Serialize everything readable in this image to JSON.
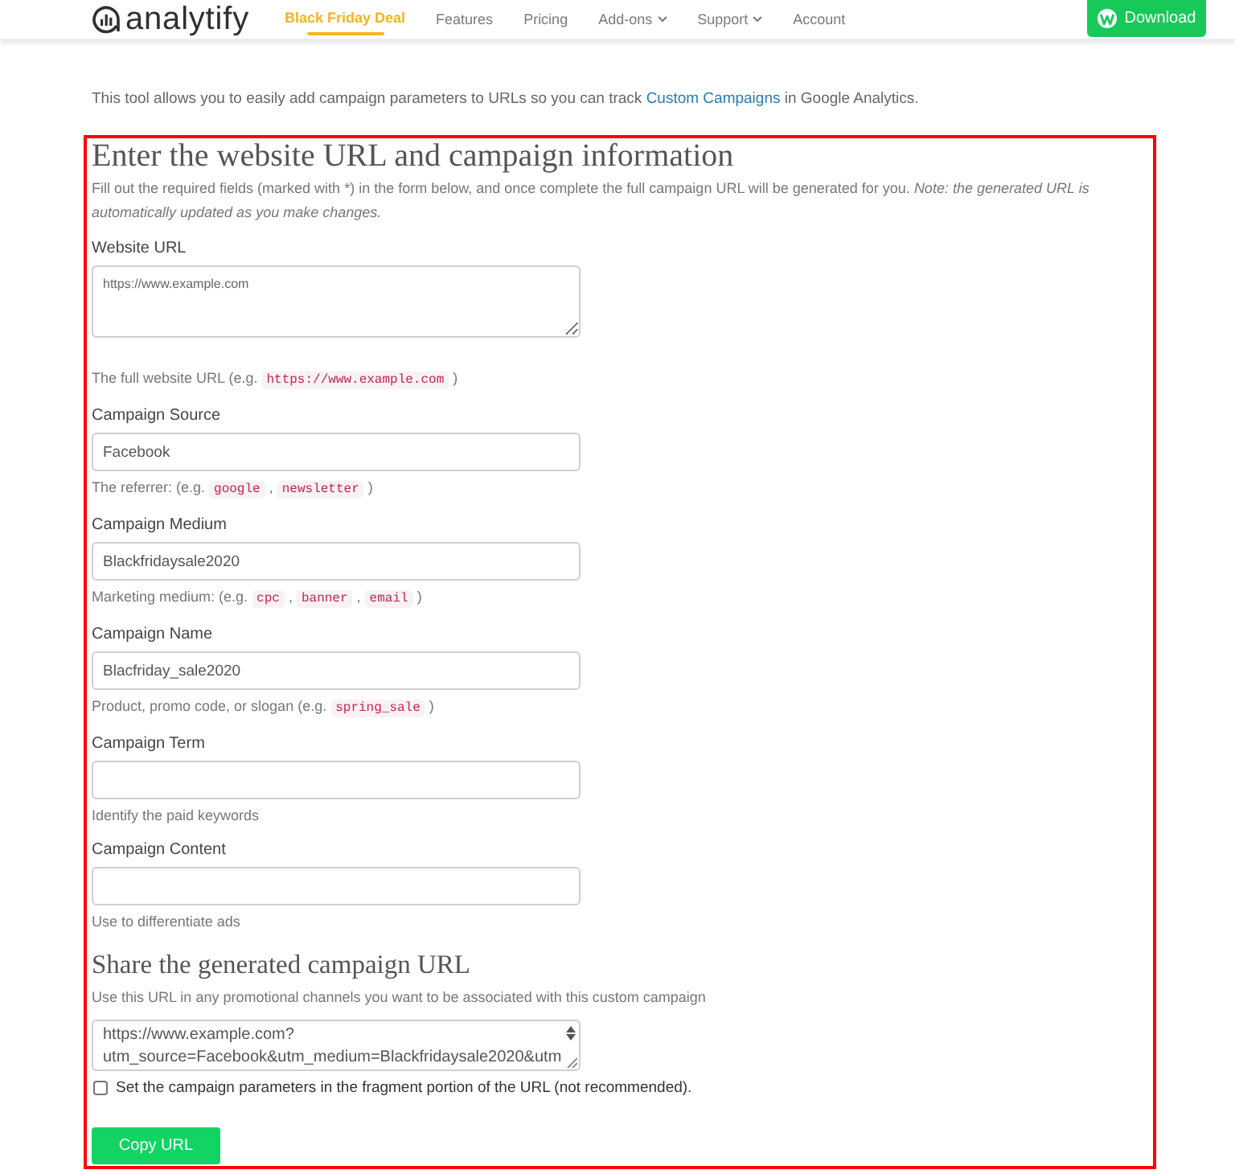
{
  "header": {
    "logo_text": "analytify",
    "nav": [
      {
        "label": "Black Friday Deal",
        "kind": "deal"
      },
      {
        "label": "Features",
        "kind": "link"
      },
      {
        "label": "Pricing",
        "kind": "link"
      },
      {
        "label": "Add-ons",
        "kind": "dropdown"
      },
      {
        "label": "Support",
        "kind": "dropdown"
      },
      {
        "label": "Account",
        "kind": "link"
      }
    ],
    "download_button": "Download"
  },
  "intro": {
    "text_before": "This tool allows you to easily add campaign parameters to URLs so you can track ",
    "link": "Custom Campaigns",
    "text_after": " in Google Analytics."
  },
  "form": {
    "title": "Enter the website URL and campaign information",
    "description": "Fill out the required fields (marked with *) in the form below, and once complete the full campaign URL will be generated for you. *Note: the generated URL is automatically updated as you make changes.*",
    "fields": [
      {
        "label": "Website URL",
        "kind": "textarea",
        "placeholder": "https://www.example.com",
        "help": [
          {
            "kind": "text",
            "text": "The full website URL (e.g. "
          },
          {
            "kind": "code",
            "text": "https://www.example.com"
          },
          {
            "kind": "text",
            "text": " )"
          }
        ]
      },
      {
        "label": "Campaign Source",
        "kind": "input",
        "value": "Facebook",
        "help": [
          {
            "kind": "text",
            "text": "The referrer: (e.g. "
          },
          {
            "kind": "code",
            "text": "google"
          },
          {
            "kind": "text",
            "text": " , "
          },
          {
            "kind": "code",
            "text": "newsletter"
          },
          {
            "kind": "text",
            "text": " )"
          }
        ]
      },
      {
        "label": "Campaign Medium",
        "kind": "input",
        "value": "Blackfridaysale2020",
        "help": [
          {
            "kind": "text",
            "text": "Marketing medium: (e.g. "
          },
          {
            "kind": "code",
            "text": "cpc"
          },
          {
            "kind": "text",
            "text": " , "
          },
          {
            "kind": "code",
            "text": "banner"
          },
          {
            "kind": "text",
            "text": " , "
          },
          {
            "kind": "code",
            "text": "email"
          },
          {
            "kind": "text",
            "text": " )"
          }
        ]
      },
      {
        "label": "Campaign Name",
        "kind": "input",
        "value": "Blacfriday_sale2020",
        "help": [
          {
            "kind": "text",
            "text": "Product, promo code, or slogan (e.g. "
          },
          {
            "kind": "code",
            "text": "spring_sale"
          },
          {
            "kind": "text",
            "text": " )"
          }
        ]
      },
      {
        "label": "Campaign Term",
        "kind": "input",
        "help": [
          {
            "kind": "text",
            "text": "Identify the paid keywords"
          }
        ]
      },
      {
        "label": "Campaign Content",
        "kind": "input",
        "help": [
          {
            "kind": "text",
            "text": "Use to differentiate ads"
          }
        ]
      }
    ]
  },
  "share": {
    "title": "Share the generated campaign URL",
    "help": "Use this URL in any promotional channels you want to be associated with this custom campaign",
    "url_lines": [
      "https://www.example.com?",
      "utm_source=Facebook&utm_medium=Blackfridaysale2020&utm"
    ],
    "fragment_option": {
      "label": "Set the campaign parameters in the fragment portion of the URL (not recommended).",
      "checked": false
    },
    "copy_button": "Copy URL"
  }
}
